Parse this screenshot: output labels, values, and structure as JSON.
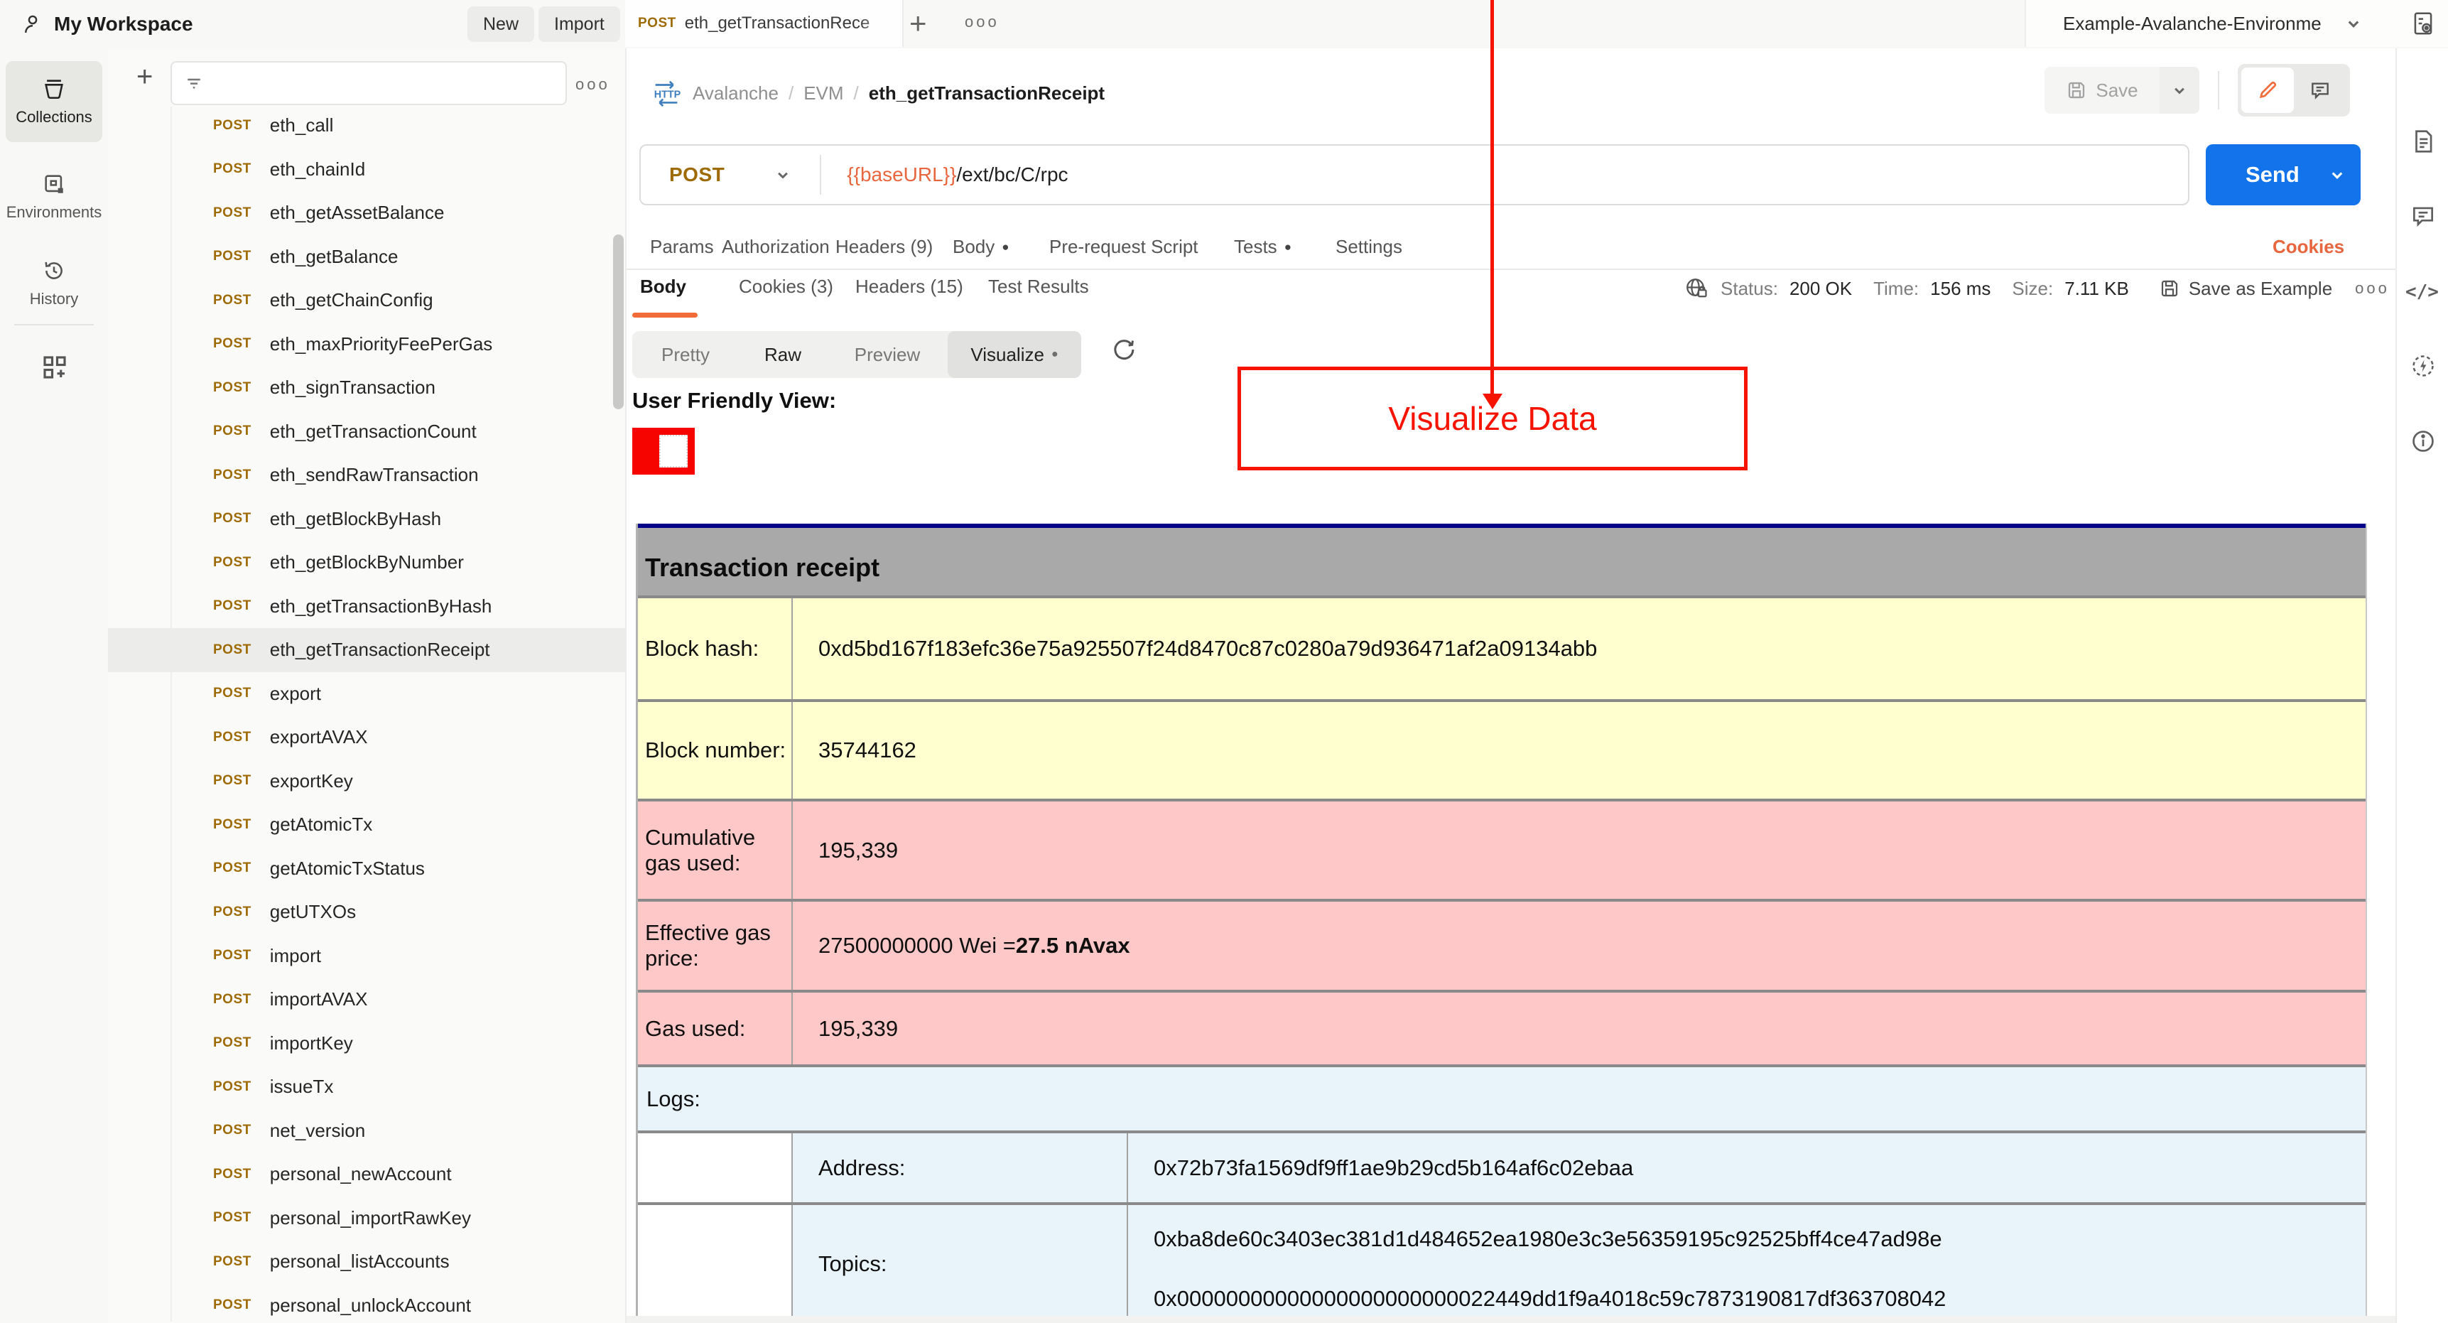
{
  "topbar": {
    "workspace": "My Workspace",
    "new_label": "New",
    "import_label": "Import",
    "tab": {
      "method": "POST",
      "title": "eth_getTransactionRece"
    },
    "environment": "Example-Avalanche-Environme"
  },
  "request_header": {
    "breadcrumb": {
      "collection": "Avalanche",
      "folder": "EVM",
      "request": "eth_getTransactionReceipt",
      "separator": "/"
    },
    "save_label": "Save"
  },
  "url_row": {
    "method": "POST",
    "url_variable": "{{baseURL}}",
    "url_path": "/ext/bc/C/rpc",
    "send_label": "Send"
  },
  "request_tabs": {
    "params": "Params",
    "authorization": "Authorization",
    "headers": "Headers (9)",
    "body": "Body",
    "body_dot": "●",
    "prerequest": "Pre-request Script",
    "tests": "Tests",
    "tests_dot": "●",
    "settings": "Settings",
    "cookies_link": "Cookies"
  },
  "response_bar": {
    "tab_body": "Body",
    "tab_cookies": "Cookies (3)",
    "tab_headers": "Headers (15)",
    "tab_test_results": "Test Results",
    "status_label": "Status:",
    "status_value": "200 OK",
    "time_label": "Time:",
    "time_value": "156 ms",
    "size_label": "Size:",
    "size_value": "7.11 KB",
    "save_as_example": "Save as Example"
  },
  "view_bar": {
    "pretty": "Pretty",
    "raw": "Raw",
    "preview": "Preview",
    "visualize": "Visualize",
    "visualize_dot": "●",
    "active": "Visualize"
  },
  "visualizer": {
    "heading": "User Friendly View:",
    "annotation": "Visualize Data",
    "table_title": "Transaction receipt",
    "rows": [
      {
        "label": "Block hash:",
        "value": "0xd5bd167f183efc36e75a925507f24d8470c87c0280a79d936471af2a09134abb",
        "value_bold": "",
        "tone": "yellow"
      },
      {
        "label": "Block number:",
        "value": "35744162",
        "value_bold": "",
        "tone": "yellow"
      },
      {
        "label": "Cumulative gas used:",
        "value": "195,339",
        "value_bold": "",
        "tone": "pink"
      },
      {
        "label": "Effective gas price:",
        "value": "27500000000 Wei = ",
        "value_bold": "27.5 nAvax",
        "tone": "pink"
      },
      {
        "label": "Gas used:",
        "value": "195,339",
        "value_bold": "",
        "tone": "pink"
      }
    ],
    "logs_label": "Logs:",
    "log": {
      "address_label": "Address:",
      "address": "0x72b73fa1569df9ff1ae9b29cd5b164af6c02ebaa",
      "topics_label": "Topics:",
      "topics": [
        "0xba8de60c3403ec381d1d484652ea1980e3c3e56359195c92525bff4ce47ad98e",
        "0x00000000000000000000000022449dd1f9a4018c59c7873190817df363708042"
      ]
    }
  },
  "left_rail": {
    "collections": "Collections",
    "environments": "Environments",
    "history": "History"
  },
  "sidebar": {
    "active_item": "eth_getTransactionReceipt",
    "items": [
      {
        "method": "POST",
        "name": "eth_call"
      },
      {
        "method": "POST",
        "name": "eth_chainId"
      },
      {
        "method": "POST",
        "name": "eth_getAssetBalance"
      },
      {
        "method": "POST",
        "name": "eth_getBalance"
      },
      {
        "method": "POST",
        "name": "eth_getChainConfig"
      },
      {
        "method": "POST",
        "name": "eth_maxPriorityFeePerGas"
      },
      {
        "method": "POST",
        "name": "eth_signTransaction"
      },
      {
        "method": "POST",
        "name": "eth_getTransactionCount"
      },
      {
        "method": "POST",
        "name": "eth_sendRawTransaction"
      },
      {
        "method": "POST",
        "name": "eth_getBlockByHash"
      },
      {
        "method": "POST",
        "name": "eth_getBlockByNumber"
      },
      {
        "method": "POST",
        "name": "eth_getTransactionByHash"
      },
      {
        "method": "POST",
        "name": "eth_getTransactionReceipt"
      },
      {
        "method": "POST",
        "name": "export"
      },
      {
        "method": "POST",
        "name": "exportAVAX"
      },
      {
        "method": "POST",
        "name": "exportKey"
      },
      {
        "method": "POST",
        "name": "getAtomicTx"
      },
      {
        "method": "POST",
        "name": "getAtomicTxStatus"
      },
      {
        "method": "POST",
        "name": "getUTXOs"
      },
      {
        "method": "POST",
        "name": "import"
      },
      {
        "method": "POST",
        "name": "importAVAX"
      },
      {
        "method": "POST",
        "name": "importKey"
      },
      {
        "method": "POST",
        "name": "issueTx"
      },
      {
        "method": "POST",
        "name": "net_version"
      },
      {
        "method": "POST",
        "name": "personal_newAccount"
      },
      {
        "method": "POST",
        "name": "personal_importRawKey"
      },
      {
        "method": "POST",
        "name": "personal_listAccounts"
      },
      {
        "method": "POST",
        "name": "personal_unlockAccount"
      }
    ]
  },
  "colors": {
    "accent_orange": "#f26b3a",
    "variable_orange": "#e8663d",
    "post_badge": "#9e6a03",
    "send_blue": "#1273eb",
    "annotation_red": "#f61400",
    "table_top_border": "#00008b",
    "table_header_bg": "#a9a9a9",
    "row_yellow": "#ffffcf",
    "row_pink": "#ffc8c8",
    "row_blue": "#e9f3fa"
  }
}
